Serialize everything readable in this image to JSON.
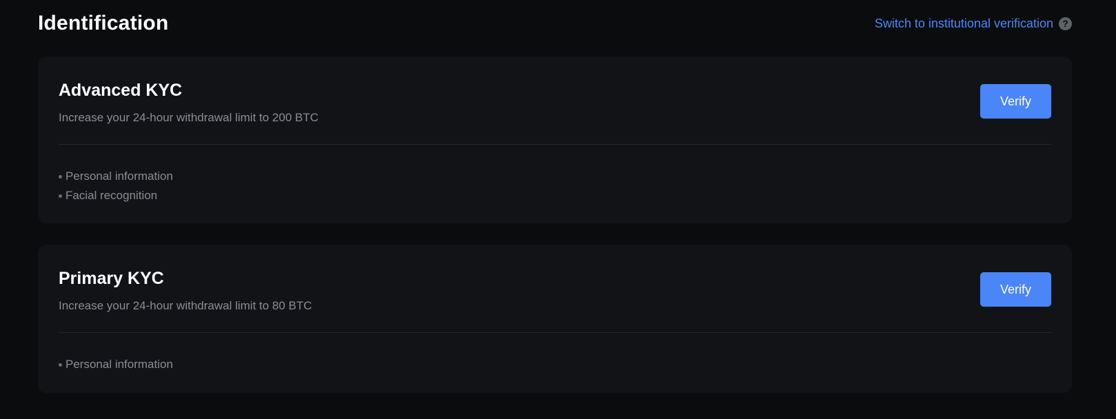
{
  "header": {
    "title": "Identification",
    "switch_link": "Switch to institutional verification",
    "help_icon": "question-circle-icon"
  },
  "cards": [
    {
      "title": "Advanced KYC",
      "subtitle": "Increase your 24-hour withdrawal limit to 200 BTC",
      "button": "Verify",
      "requirements": [
        "Personal information",
        "Facial recognition"
      ]
    },
    {
      "title": "Primary KYC",
      "subtitle": "Increase your 24-hour withdrawal limit to 80 BTC",
      "button": "Verify",
      "requirements": [
        "Personal information"
      ]
    }
  ],
  "colors": {
    "background": "#0b0c0e",
    "card": "#121316",
    "accent": "#4a86f7",
    "muted_text": "#8a8d93"
  }
}
